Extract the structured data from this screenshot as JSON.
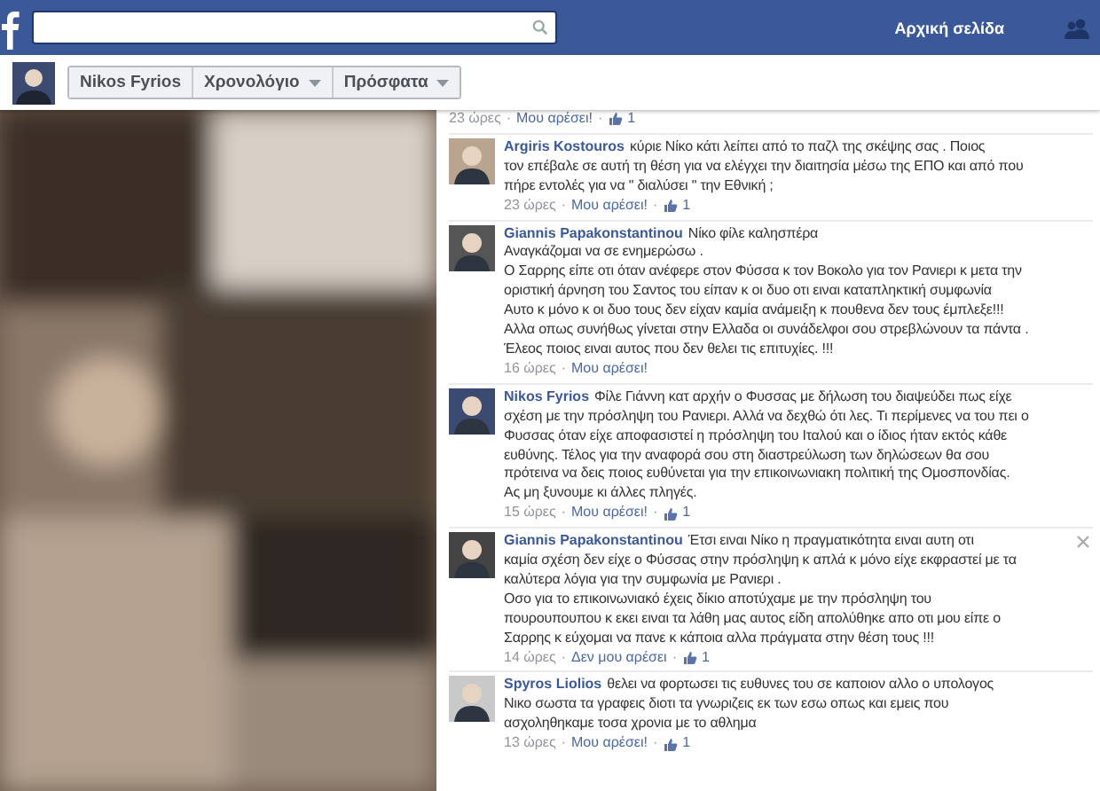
{
  "top_bar": {
    "home_link": "Αρχική σελίδα"
  },
  "profile_bar": {
    "buttons": [
      {
        "label": "Nikos Fyrios",
        "dropdown": false
      },
      {
        "label": "Χρονολόγιο",
        "dropdown": true
      },
      {
        "label": "Πρόσφατα",
        "dropdown": true
      }
    ]
  },
  "separator": "·",
  "previous_meta": {
    "time": "23 ώρες",
    "like": "Μου αρέσει!",
    "likes": "1"
  },
  "comments": [
    {
      "author": "Argiris Kostouros",
      "lines": [
        "κύριε Νίκο κάτι λείπει από το παζλ της σκέψης σας . Ποιος",
        "τον επέβαλε σε αυτή τη θέση για να ελέγχει την διαιτησία μέσω της ΕΠΟ και από που",
        "πήρε εντολές για να \" διαλύσει \" την Εθνική ;"
      ],
      "time": "23 ώρες",
      "like": "Μου αρέσει!",
      "likes": "1",
      "removable": false
    },
    {
      "author": "Giannis Papakonstantinou",
      "lines": [
        "Νίκο φίλε καλησπέρα",
        "Αναγκάζομαι να σε ενημερώσω .",
        "Ο Σαρρης είπε οτι όταν ανέφερε στον Φύσσα κ τον Βοκολο για τον Ρανιερι κ μετα την",
        "οριστική άρνηση του Σαντος του είπαν κ οι δυο οτι ειναι καταπληκτική συμφωνία",
        "Αυτο κ μόνο κ οι δυο τους δεν είχαν καμία ανάμειξη κ πουθενα δεν τους έμπλεξε!!!",
        "Αλλα οπως συνήθως γίνεται στην Ελλαδα οι συνάδελφοι σου στρεβλώνουν τα πάντα .",
        "Έλεος ποιος ειναι αυτος που δεν θελει τις επιτυχίες. !!!"
      ],
      "time": "16 ώρες",
      "like": "Μου αρέσει!",
      "removable": false
    },
    {
      "author": "Nikos Fyrios",
      "lines": [
        "Φίλε Γιάννη κατ αρχήν ο Φυσσας με δήλωση του διαψεύδει πως είχε",
        "σχέση με την πρόσληψη του Ρανιερι. Αλλά να δεχθώ ότι λες. Τι περίμενες να του πει ο",
        "Φυσσας όταν είχε αποφασιστεί η πρόσληψη του Ιταλού και ο ίδιος ήταν εκτός κάθε",
        "ευθύνης. Τέλος για την αναφορά σου στη διαστρεύλωση των δηλώσεων θα σου",
        "πρότεινα να δεις ποιος ευθύνεται για την επικοινωνιακη πολιτική της Ομοσπονδίας.",
        "Ας μη ξυνουμε κι άλλες πληγές."
      ],
      "time": "15 ώρες",
      "like": "Μου αρέσει!",
      "likes": "1",
      "removable": false
    },
    {
      "author": "Giannis Papakonstantinou",
      "lines": [
        "Έτσι ειναι Νίκο η πραγματικότητα ειναι αυτη οτι",
        "καμία σχέση δεν είχε ο Φύσσας στην πρόσληψη κ απλά κ μόνο είχε εκφραστεί με τα",
        "καλύτερα λόγια για την συμφωνία με Ρανιερι .",
        "Οσο για το επικοινωνιακό έχεις δίκιο αποτύχαμε με την πρόσληψη του",
        "πουρουπουπου κ εκει ειναι τα λάθη μας αυτος είδη απολύθηκε απο οτι μου είπε ο",
        "Σαρρης κ εύχομαι να πανε κ κάποια αλλα πράγματα στην θέση τους !!!"
      ],
      "time": "14 ώρες",
      "like": "Δεν μου αρέσει",
      "likes": "1",
      "removable": true
    },
    {
      "author": "Spyros Liolios",
      "lines": [
        "θελει να φορτωσει τις ευθυνες του σε καποιον αλλο ο υπολογος",
        "Νικο σωστα τα γραφεις διοτι τα γνωριζεις εκ των εσω οπως και εμεις που",
        "ασχοληθηκαμε τοσα χρονια με το αθλημα"
      ],
      "time": "13 ώρες",
      "like": "Μου αρέσει!",
      "likes": "1",
      "removable": false
    }
  ]
}
